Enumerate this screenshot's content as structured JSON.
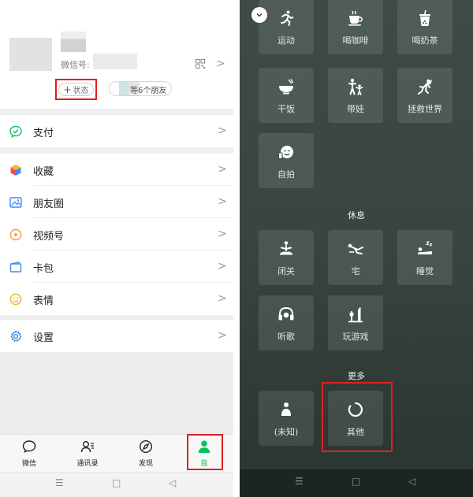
{
  "profile": {
    "wechat_id_label": "微信号:",
    "status_label": "状态",
    "friends_label": "等6个朋友"
  },
  "menu": {
    "pay": "支付",
    "favorites": "收藏",
    "moments": "朋友圈",
    "channels": "视频号",
    "cards": "卡包",
    "stickers": "表情",
    "settings": "设置"
  },
  "tabbar": {
    "tabs": [
      {
        "label": "微信",
        "icon": "chat-bubble-icon"
      },
      {
        "label": "通讯录",
        "icon": "contacts-icon"
      },
      {
        "label": "发现",
        "icon": "compass-icon"
      },
      {
        "label": "我",
        "icon": "person-icon"
      }
    ],
    "active_index": 3
  },
  "status_panel": {
    "top_tiles": [
      "运动",
      "喝咖啡",
      "喝奶茶",
      "干饭",
      "带娃",
      "拯救世界",
      "自拍"
    ],
    "rest_title": "休息",
    "rest_tiles": [
      "闭关",
      "宅",
      "睡觉",
      "听歌",
      "玩游戏"
    ],
    "more_title": "更多",
    "more_tiles": [
      "(未知)",
      "其他"
    ]
  },
  "colors": {
    "wechat_green": "#07c160",
    "highlight_red": "#e12020",
    "panel_bg": "#394640"
  }
}
